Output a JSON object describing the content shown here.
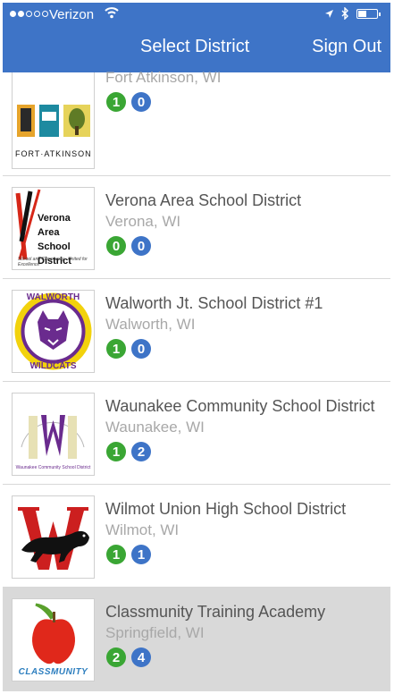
{
  "status_bar": {
    "carrier": "Verizon"
  },
  "nav": {
    "title": "Select District",
    "sign_out": "Sign Out"
  },
  "search": {
    "placeholder": ""
  },
  "districts": [
    {
      "name": "",
      "location": "Fort Atkinson, WI",
      "green": "1",
      "blue": "0",
      "logo_text": "FORT·ATKINSON"
    },
    {
      "name": "Verona Area School District",
      "location": "Verona, WI",
      "green": "0",
      "blue": "0",
      "logo_text": "Verona Area School District",
      "logo_sub": "School and Community - United for Excellence"
    },
    {
      "name": "Walworth Jt. School District #1",
      "location": "Walworth, WI",
      "green": "1",
      "blue": "0",
      "logo_top": "WALWORTH",
      "logo_bottom": "WILDCATS"
    },
    {
      "name": "Waunakee Community School District",
      "location": "Waunakee, WI",
      "green": "1",
      "blue": "2",
      "logo_text": "Waunakee Community School District"
    },
    {
      "name": "Wilmot Union High School District",
      "location": "Wilmot, WI",
      "green": "1",
      "blue": "1"
    },
    {
      "name": "Classmunity Training Academy",
      "location": "Springfield, WI",
      "green": "2",
      "blue": "4",
      "logo_text": "CLASSMUNITY"
    }
  ],
  "colors": {
    "header": "#3e74c7",
    "green": "#3aa634",
    "blue": "#3e74c7",
    "selected": "#d9d9d9"
  }
}
